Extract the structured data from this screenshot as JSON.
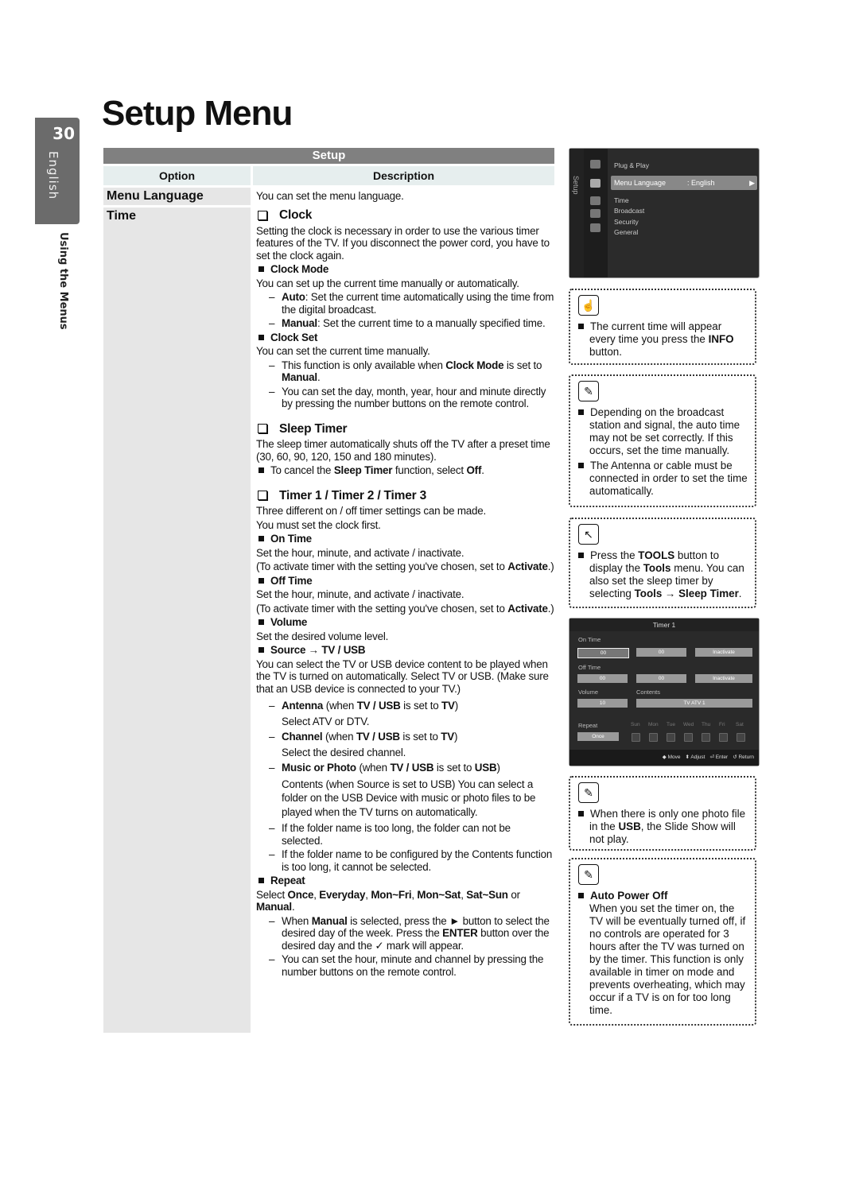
{
  "side": {
    "page_number": "30",
    "language": "English",
    "section": "Using the Menus"
  },
  "title": "Setup Menu",
  "table": {
    "heading": "Setup",
    "col_option": "Option",
    "col_description": "Description",
    "rows": [
      {
        "option": "Menu Language",
        "description": "You can set the menu language."
      },
      {
        "option": "Time"
      }
    ]
  },
  "time": {
    "clock": {
      "heading": "Clock",
      "intro": "Setting the clock is necessary in order to use the various timer features of the TV. If you disconnect the power cord, you have to set the clock again.",
      "mode_title": "Clock Mode",
      "mode_text": "You can set up the current time manually or automatically.",
      "auto_label": "Auto",
      "auto_text": ": Set the current time automatically using the time from the digital broadcast.",
      "manual_label": "Manual",
      "manual_text": ": Set the current time to a manually specified time.",
      "set_title": "Clock Set",
      "set_text": "You can set the current time manually.",
      "set_note1_a": "This function is only available when ",
      "set_note1_b": "Clock Mode",
      "set_note1_c": " is set to ",
      "set_note1_d": "Manual",
      "set_note1_e": ".",
      "set_note2": "You can set the day, month, year, hour and minute directly by pressing the number buttons on the remote control."
    },
    "sleep": {
      "heading": "Sleep Timer",
      "text": "The sleep timer automatically shuts off the TV after a preset time (30, 60, 90, 120, 150 and 180 minutes).",
      "cancel_a": "To cancel the ",
      "cancel_b": "Sleep Timer",
      "cancel_c": " function, select ",
      "cancel_d": "Off",
      "cancel_e": "."
    },
    "timers": {
      "heading": "Timer 1 / Timer 2 / Timer 3",
      "line1": "Three different on / off timer settings can be made.",
      "line2": "You must set the clock first.",
      "on_title": "On Time",
      "on_text": "Set the hour, minute, and activate / inactivate.",
      "activate_a": "(To activate timer with the setting you've chosen, set to ",
      "activate_b": "Activate",
      "activate_c": ".)",
      "off_title": "Off Time",
      "off_text": "Set the hour, minute, and activate / inactivate.",
      "volume_title": "Volume",
      "volume_text": "Set the desired volume level.",
      "source_title": "Source → TV / USB",
      "source_text": "You can select the TV or USB device content to be played when the TV is turned on automatically. Select TV or USB. (Make sure that an USB device is connected to your TV.)",
      "antenna_b": "Antenna",
      "antenna_r": " (when ",
      "antenna_tvusb": "TV / USB",
      "antenna_is": " is set to ",
      "antenna_tv": "TV",
      "antenna_close": ")",
      "antenna_text": "Select ATV or DTV.",
      "channel_b": "Channel",
      "channel_text": "Select the desired channel.",
      "music_b": "Music or Photo",
      "music_usb": "USB",
      "music_text": "Contents (when Source is set to USB) You can select a folder on the USB Device with music or photo files to be played when the TV turns on automatically.",
      "folder_note1": "If the folder name is too long, the folder can not be selected.",
      "folder_note2": "If the folder name to be configured by the Contents function is too long, it cannot be selected.",
      "repeat_title": "Repeat",
      "repeat_a": "Select ",
      "repeat_once": "Once",
      "repeat_everyday": "Everyday",
      "repeat_monfri": "Mon~Fri",
      "repeat_monsat": "Mon~Sat",
      "repeat_satsun": "Sat~Sun",
      "repeat_or": " or ",
      "repeat_manual": "Manual",
      "manual_note_a": "When ",
      "manual_note_b": "Manual",
      "manual_note_c": " is selected, press the ► button to select the desired day of the week. Press the ",
      "manual_note_d": "ENTER",
      "manual_note_e": " button over the desired day and the ✓ mark will appear.",
      "final_note": "You can set the hour, minute and channel by pressing the number buttons on the remote control."
    }
  },
  "tv_menu": {
    "rail_label": "Setup",
    "items": [
      "Plug & Play",
      "Time",
      "Broadcast",
      "Security",
      "General"
    ],
    "highlight_label": "Menu Language",
    "highlight_value": ": English"
  },
  "notes": {
    "info": {
      "a": "The current time will appear every time you press the ",
      "b": "INFO",
      "c": " button."
    },
    "broadcast": [
      "Depending on the broadcast station and signal, the auto time may not be set correctly. If this occurs, set the time manually.",
      "The Antenna or cable must be connected in order to set the time automatically."
    ],
    "tools": {
      "a": "Press the ",
      "b": "TOOLS",
      "c": " button to display the ",
      "d": "Tools",
      "e": " menu. You can also set the sleep timer by selecting ",
      "f": "Tools → Sleep Timer",
      "g": "."
    },
    "usb": {
      "a": "When there is only one photo file in the ",
      "b": "USB",
      "c": ", the Slide Show will not play."
    },
    "auto_power": {
      "title": "Auto Power Off",
      "text": "When you set the timer on, the TV will be eventually turned off, if no controls are operated for 3 hours after the TV was turned on by the timer. This function is only available in timer on mode and prevents overheating, which may occur if a TV is on for too long time."
    }
  },
  "timer_screen": {
    "title": "Timer 1",
    "on_time_label": "On Time",
    "on_hour": "00",
    "on_min": "00",
    "on_state": "Inactivate",
    "off_time_label": "Off Time",
    "off_hour": "00",
    "off_min": "00",
    "off_state": "Inactivate",
    "volume_label": "Volume",
    "volume_value": "10",
    "contents_label": "Contents",
    "contents_value": "TV  ATV  1",
    "repeat_label": "Repeat",
    "repeat_value": "Once",
    "days": [
      "Sun",
      "Mon",
      "Tue",
      "Wed",
      "Thu",
      "Fri",
      "Sat"
    ],
    "footer": [
      "◆ Move",
      "⬍ Adjust",
      "⏎ Enter",
      "↺ Return"
    ]
  }
}
